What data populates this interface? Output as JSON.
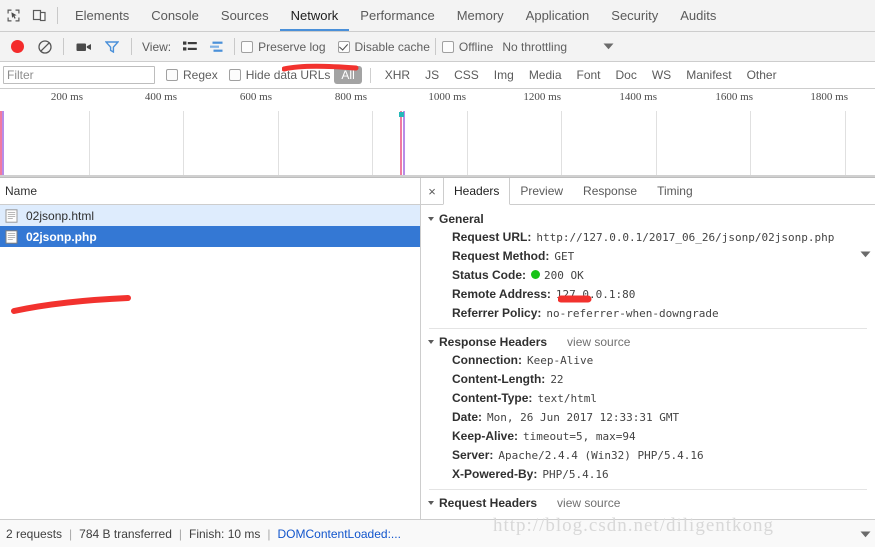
{
  "devtools": {
    "icons": {
      "inspect": "inspect-element-icon",
      "device": "device-toolbar-icon"
    },
    "main_tabs": [
      {
        "label": "Elements",
        "selected": false
      },
      {
        "label": "Console",
        "selected": false
      },
      {
        "label": "Sources",
        "selected": false
      },
      {
        "label": "Network",
        "selected": true
      },
      {
        "label": "Performance",
        "selected": false
      },
      {
        "label": "Memory",
        "selected": false
      },
      {
        "label": "Application",
        "selected": false
      },
      {
        "label": "Security",
        "selected": false
      },
      {
        "label": "Audits",
        "selected": false
      }
    ]
  },
  "toolbar": {
    "record_title": "record-button",
    "clear_title": "clear-button",
    "camera_title": "capture-screenshots-icon",
    "funnel_title": "filter-icon",
    "view_label": "View:",
    "view_list_title": "list-view-icon",
    "view_waterfall_title": "waterfall-view-icon",
    "preserve_log": {
      "label": "Preserve log",
      "checked": false
    },
    "disable_cache": {
      "label": "Disable cache",
      "checked": true
    },
    "offline": {
      "label": "Offline",
      "checked": false
    },
    "throttling": "No throttling"
  },
  "filter_row": {
    "filter_placeholder": "Filter",
    "filter_value": "",
    "regex": {
      "label": "Regex",
      "checked": false
    },
    "hide_data_urls": {
      "label": "Hide data URLs",
      "checked": false
    },
    "types": [
      {
        "label": "All",
        "active": true
      },
      {
        "label": "XHR",
        "active": false
      },
      {
        "label": "JS",
        "active": false
      },
      {
        "label": "CSS",
        "active": false
      },
      {
        "label": "Img",
        "active": false
      },
      {
        "label": "Media",
        "active": false
      },
      {
        "label": "Font",
        "active": false
      },
      {
        "label": "Doc",
        "active": false
      },
      {
        "label": "WS",
        "active": false
      },
      {
        "label": "Manifest",
        "active": false
      },
      {
        "label": "Other",
        "active": false
      }
    ]
  },
  "overview": {
    "ticks": [
      "200 ms",
      "400 ms",
      "600 ms",
      "800 ms",
      "1000 ms",
      "1200 ms",
      "1400 ms",
      "1600 ms",
      "1800 ms"
    ],
    "marker_colors": {
      "dom_content_loaded": "#f07ba0",
      "load": "#b88ce8",
      "resource_bar": "#26b8b8"
    }
  },
  "request_list": {
    "column_header": "Name",
    "rows": [
      {
        "name": "02jsonp.html",
        "state": "hovered",
        "icon": "document-icon"
      },
      {
        "name": "02jsonp.php",
        "state": "selected",
        "icon": "document-icon"
      }
    ]
  },
  "detail": {
    "close_label": "×",
    "tabs": [
      {
        "label": "Headers",
        "selected": true
      },
      {
        "label": "Preview",
        "selected": false
      },
      {
        "label": "Response",
        "selected": false
      },
      {
        "label": "Timing",
        "selected": false
      }
    ],
    "general": {
      "title": "General",
      "rows": [
        {
          "key": "Request URL:",
          "value": "http://127.0.0.1/2017_06_26/jsonp/02jsonp.php"
        },
        {
          "key": "Request Method:",
          "value": "GET"
        },
        {
          "key": "Status Code:",
          "value": "200 OK",
          "has_status_dot": true,
          "status_color": "#19c319"
        },
        {
          "key": "Remote Address:",
          "value": "127.0.0.1:80"
        },
        {
          "key": "Referrer Policy:",
          "value": "no-referrer-when-downgrade"
        }
      ]
    },
    "response_headers": {
      "title": "Response Headers",
      "view_source": "view source",
      "rows": [
        {
          "key": "Connection:",
          "value": "Keep-Alive"
        },
        {
          "key": "Content-Length:",
          "value": "22"
        },
        {
          "key": "Content-Type:",
          "value": "text/html"
        },
        {
          "key": "Date:",
          "value": "Mon, 26 Jun 2017 12:33:31 GMT"
        },
        {
          "key": "Keep-Alive:",
          "value": "timeout=5, max=94"
        },
        {
          "key": "Server:",
          "value": "Apache/2.4.4 (Win32) PHP/5.4.16"
        },
        {
          "key": "X-Powered-By:",
          "value": "PHP/5.4.16"
        }
      ]
    },
    "request_headers": {
      "title": "Request Headers",
      "view_source": "view source"
    }
  },
  "statusbar": {
    "requests": "2 requests",
    "transferred": "784 B transferred",
    "finish": "Finish: 10 ms",
    "dom_content_loaded": "DOMContentLoaded:...",
    "separator": "|"
  },
  "watermark": "http://blog.csdn.net/diligentkong",
  "annotation_color": "#f2322e"
}
